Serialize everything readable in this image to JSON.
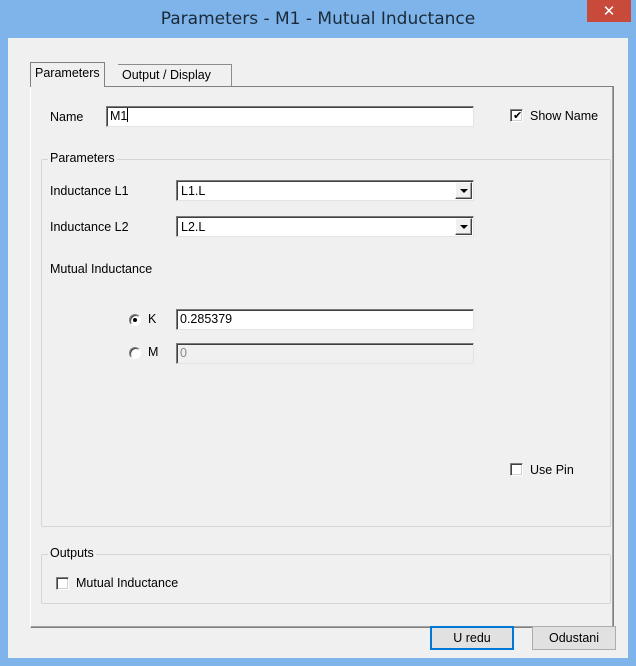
{
  "window": {
    "title": "Parameters - M1 - Mutual Inductance",
    "close_glyph": "✕"
  },
  "tabs": [
    {
      "label": "Parameters",
      "active": true
    },
    {
      "label": "Output / Display",
      "active": false
    }
  ],
  "name_row": {
    "label": "Name",
    "value": "M1",
    "show_name_label": "Show Name",
    "show_name_checked": true
  },
  "parameters_group": {
    "title": "Parameters",
    "inductance_l1_label": "Inductance L1",
    "inductance_l1_value": "L1.L",
    "inductance_l2_label": "Inductance L2",
    "inductance_l2_value": "L2.L",
    "mutual_inductance_label": "Mutual Inductance",
    "k_label": "K",
    "k_value": "0.285379",
    "k_selected": true,
    "m_label": "M",
    "m_value": "0",
    "m_selected": false,
    "use_pin_label": "Use Pin",
    "use_pin_checked": false
  },
  "outputs_group": {
    "title": "Outputs",
    "mutual_inductance_label": "Mutual Inductance",
    "mutual_inductance_checked": false
  },
  "buttons": {
    "ok_label": "U redu",
    "cancel_label": "Odustani"
  },
  "icons": {
    "check_glyph": "✔",
    "dropdown": "chevron-down-icon"
  },
  "colors": {
    "titlebar": "#7eb4ea",
    "close_button": "#c74a3a",
    "dialog_face": "#f0f0f0",
    "default_button_border": "#0078d7"
  }
}
